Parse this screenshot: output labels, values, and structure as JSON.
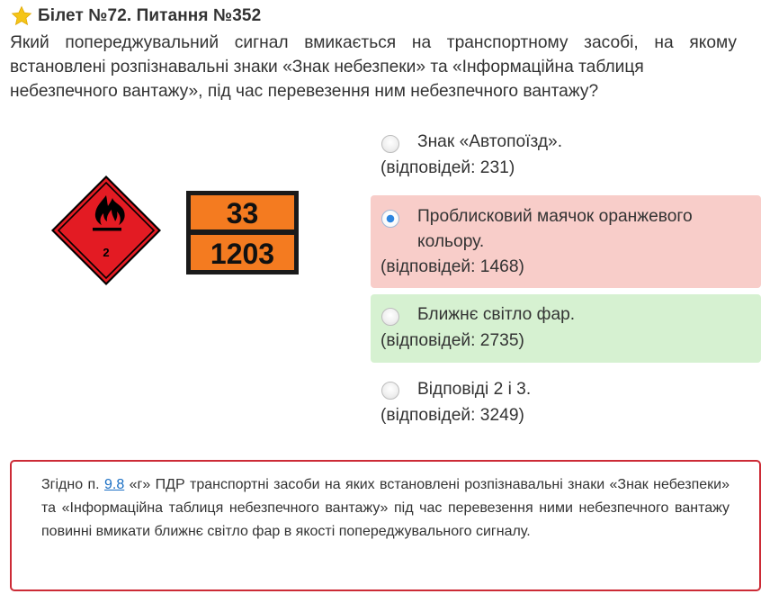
{
  "header": {
    "star_icon": "star-icon",
    "title": "Білет №72. Питання №352"
  },
  "question": {
    "text_main": "Який попереджувальний сигнал вмикається на транспортному засобі, на якому встановлені розпізнавальні знаки «Знак небезпеки» та «Інформаційна таблиця",
    "text_last": "небезпечного вантажу», під час перевезення ним небезпечного вантажу?"
  },
  "image": {
    "diamond_colors": {
      "fill": "#e31b23",
      "border": "#000000"
    },
    "plate": {
      "top_number": "33",
      "bottom_number": "1203",
      "color": "#f47b20"
    }
  },
  "options": [
    {
      "label": "Знак «Автопоїзд».",
      "votes": "(відповідей: 231)",
      "state": "normal",
      "checked": false
    },
    {
      "label": "Проблисковий маячок оранжевого кольору.",
      "votes": "(відповідей: 1468)",
      "state": "wrong",
      "checked": true
    },
    {
      "label": "Ближнє світло фар.",
      "votes": "(відповідей: 2735)",
      "state": "correct",
      "checked": false
    },
    {
      "label": "Відповіді 2 і 3.",
      "votes": "(відповідей: 3249)",
      "state": "normal",
      "checked": false
    }
  ],
  "explanation": {
    "prefix": "Згідно п. ",
    "link_text": "9.8",
    "suffix": " «г» ПДР транспортні засоби на яких встановлені розпізнавальні знаки «Знак небезпеки» та «Інформаційна таблиця небезпечного вантажу» під час перевезення ними небезпечного вантажу повинні вмикати ближнє світло фар в якості попереджувального сигналу."
  },
  "colors": {
    "wrong_bg": "#f8cdc9",
    "correct_bg": "#d6f1d1",
    "explanation_border": "#cc2b36",
    "link": "#1a6fc4",
    "star": "#f5c518"
  }
}
